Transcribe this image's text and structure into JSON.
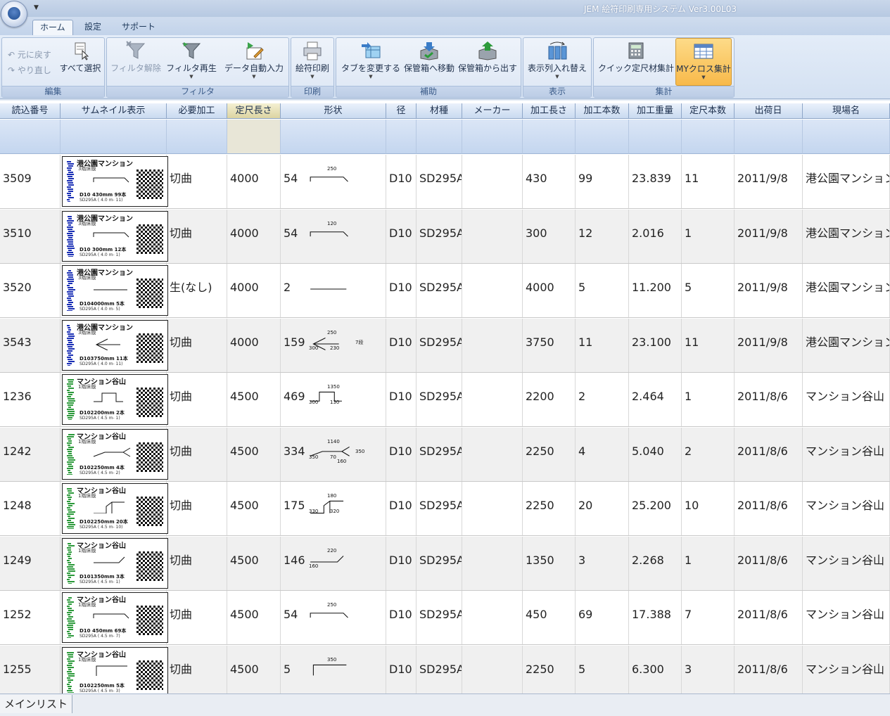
{
  "window": {
    "title": "JEM 絵符印刷専用システム Ver3.00L03"
  },
  "tabs": [
    {
      "label": "ホーム",
      "active": true
    },
    {
      "label": "設定",
      "active": false
    },
    {
      "label": "サポート",
      "active": false
    }
  ],
  "ribbon": {
    "edit": {
      "label": "編集",
      "undo": "元に戻す",
      "redo": "やり直し",
      "select_all": "すべて選択"
    },
    "filter": {
      "label": "フィルタ",
      "clear": "フィルタ解除",
      "replay": "フィルタ再生",
      "auto_input": "データ自動入力"
    },
    "print": {
      "label": "印刷",
      "print": "絵符印刷"
    },
    "assist": {
      "label": "補助",
      "change_tab": "タブを変更する",
      "move_to_box": "保管箱へ移動",
      "take_from_box": "保管箱から出す"
    },
    "view": {
      "label": "表示",
      "reorder_columns": "表示列入れ替え"
    },
    "aggregate": {
      "label": "集計",
      "quick": "クイック定尺材集計",
      "my_cross": "MYクロス集計"
    }
  },
  "colors": {
    "selected_button": "#f8b94a",
    "header_highlight": "#dcd4a2"
  },
  "table": {
    "columns": [
      "読込番号",
      "サムネイル表示",
      "必要加工",
      "定尺長さ",
      "形状",
      "径",
      "材種",
      "メーカー",
      "加工長さ",
      "加工本数",
      "加工重量",
      "定尺本数",
      "出荷日",
      "現場名"
    ],
    "rows": [
      {
        "id": "3509",
        "thumb_title": "港公園マンション",
        "thumb_sub": "3階床版",
        "thumb_spec": "D10  430mm     99本",
        "thumb_grade": "SD295A  ( 4.0 m-  11)",
        "process": "切曲",
        "stock_len": "4000",
        "shape_no": "54",
        "shape_dims": [
          "250"
        ],
        "dia": "D10",
        "grade": "SD295A",
        "maker": "",
        "proc_len": "430",
        "proc_qty": "99",
        "weight": "23.839",
        "stock_qty": "11",
        "ship": "2011/9/8",
        "site": "港公園マンション"
      },
      {
        "id": "3510",
        "thumb_title": "港公園マンション",
        "thumb_sub": "3階床版",
        "thumb_spec": "D10  300mm     12本",
        "thumb_grade": "SD295A  ( 4.0 m-   1)",
        "process": "切曲",
        "stock_len": "4000",
        "shape_no": "54",
        "shape_dims": [
          "120"
        ],
        "dia": "D10",
        "grade": "SD295A",
        "maker": "",
        "proc_len": "300",
        "proc_qty": "12",
        "weight": "2.016",
        "stock_qty": "1",
        "ship": "2011/9/8",
        "site": "港公園マンション"
      },
      {
        "id": "3520",
        "thumb_title": "港公園マンション",
        "thumb_sub": "3階床版",
        "thumb_spec": "D104000mm      5本",
        "thumb_grade": "SD295A  ( 4.0 m-   5)",
        "process": "生(なし)",
        "stock_len": "4000",
        "shape_no": "2",
        "shape_dims": [],
        "dia": "D10",
        "grade": "SD295A",
        "maker": "",
        "proc_len": "4000",
        "proc_qty": "5",
        "weight": "11.200",
        "stock_qty": "5",
        "ship": "2011/9/8",
        "site": "港公園マンション"
      },
      {
        "id": "3543",
        "thumb_title": "港公園マンション",
        "thumb_sub": "3階床版",
        "thumb_spec": "D103750mm     11本",
        "thumb_grade": "SD295A  ( 4.0 m-  11)",
        "process": "切曲",
        "stock_len": "4000",
        "shape_no": "159",
        "shape_dims": [
          "250",
          "300",
          "230",
          "7段"
        ],
        "dia": "D10",
        "grade": "SD295A",
        "maker": "",
        "proc_len": "3750",
        "proc_qty": "11",
        "weight": "23.100",
        "stock_qty": "11",
        "ship": "2011/9/8",
        "site": "港公園マンション"
      },
      {
        "id": "1236",
        "thumb_title": "マンション谷山",
        "thumb_sub": "1階床版",
        "thumb_spec": "D102200mm      2本",
        "thumb_grade": "SD295A  ( 4.5 m-   1)",
        "process": "切曲",
        "stock_len": "4500",
        "shape_no": "469",
        "shape_dims": [
          "1350",
          "300",
          "130"
        ],
        "dia": "D10",
        "grade": "SD295A",
        "maker": "",
        "proc_len": "2200",
        "proc_qty": "2",
        "weight": "2.464",
        "stock_qty": "1",
        "ship": "2011/8/6",
        "site": "マンション谷山"
      },
      {
        "id": "1242",
        "thumb_title": "マンション谷山",
        "thumb_sub": "1階床版",
        "thumb_spec": "D102250mm      4本",
        "thumb_grade": "SD295A  ( 4.5 m-   2)",
        "process": "切曲",
        "stock_len": "4500",
        "shape_no": "334",
        "shape_dims": [
          "1140",
          "350",
          "70",
          "350",
          "160"
        ],
        "dia": "D10",
        "grade": "SD295A",
        "maker": "",
        "proc_len": "2250",
        "proc_qty": "4",
        "weight": "5.040",
        "stock_qty": "2",
        "ship": "2011/8/6",
        "site": "マンション谷山"
      },
      {
        "id": "1248",
        "thumb_title": "マンション谷山",
        "thumb_sub": "1階床版",
        "thumb_spec": "D102250mm     20本",
        "thumb_grade": "SD295A  ( 4.5 m-  10)",
        "process": "切曲",
        "stock_len": "4500",
        "shape_no": "175",
        "shape_dims": [
          "180",
          "330",
          "320"
        ],
        "dia": "D10",
        "grade": "SD295A",
        "maker": "",
        "proc_len": "2250",
        "proc_qty": "20",
        "weight": "25.200",
        "stock_qty": "10",
        "ship": "2011/8/6",
        "site": "マンション谷山"
      },
      {
        "id": "1249",
        "thumb_title": "マンション谷山",
        "thumb_sub": "1階床版",
        "thumb_spec": "D101350mm      3本",
        "thumb_grade": "SD295A  ( 4.5 m-   1)",
        "process": "切曲",
        "stock_len": "4500",
        "shape_no": "146",
        "shape_dims": [
          "220",
          "160"
        ],
        "dia": "D10",
        "grade": "SD295A",
        "maker": "",
        "proc_len": "1350",
        "proc_qty": "3",
        "weight": "2.268",
        "stock_qty": "1",
        "ship": "2011/8/6",
        "site": "マンション谷山"
      },
      {
        "id": "1252",
        "thumb_title": "マンション谷山",
        "thumb_sub": "1階床版",
        "thumb_spec": "D10  450mm     69本",
        "thumb_grade": "SD295A  ( 4.5 m-   7)",
        "process": "切曲",
        "stock_len": "4500",
        "shape_no": "54",
        "shape_dims": [
          "250"
        ],
        "dia": "D10",
        "grade": "SD295A",
        "maker": "",
        "proc_len": "450",
        "proc_qty": "69",
        "weight": "17.388",
        "stock_qty": "7",
        "ship": "2011/8/6",
        "site": "マンション谷山"
      },
      {
        "id": "1255",
        "thumb_title": "マンション谷山",
        "thumb_sub": "1階床版",
        "thumb_spec": "D102250mm      5本",
        "thumb_grade": "SD295A  ( 4.5 m-   3)",
        "process": "切曲",
        "stock_len": "4500",
        "shape_no": "5",
        "shape_dims": [
          "350"
        ],
        "dia": "D10",
        "grade": "SD295A",
        "maker": "",
        "proc_len": "2250",
        "proc_qty": "5",
        "weight": "6.300",
        "stock_qty": "3",
        "ship": "2011/8/6",
        "site": "マンション谷山"
      }
    ]
  },
  "status": {
    "tab": "メインリスト"
  }
}
